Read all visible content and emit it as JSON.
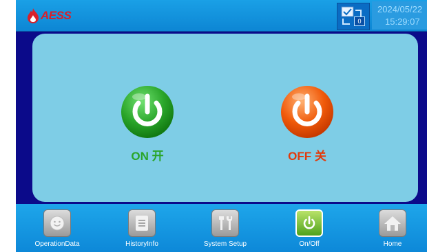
{
  "header": {
    "logo_text": "AESS",
    "date": "2024/05/22",
    "time": "15:29:07",
    "network_count": "0"
  },
  "controls": {
    "on_label": "ON 开",
    "off_label": "OFF 关"
  },
  "nav": {
    "items": [
      {
        "label": "OperationData",
        "icon": "smiley-icon"
      },
      {
        "label": "HistoryInfo",
        "icon": "document-icon"
      },
      {
        "label": "System Setup",
        "icon": "tools-icon"
      },
      {
        "label": "On/Off",
        "icon": "power-icon"
      },
      {
        "label": "Home",
        "icon": "home-icon"
      }
    ]
  },
  "colors": {
    "on": "#2aa52a",
    "off": "#f05a0a",
    "panel": "#7ecde6",
    "frame": "#0b0a8a"
  }
}
